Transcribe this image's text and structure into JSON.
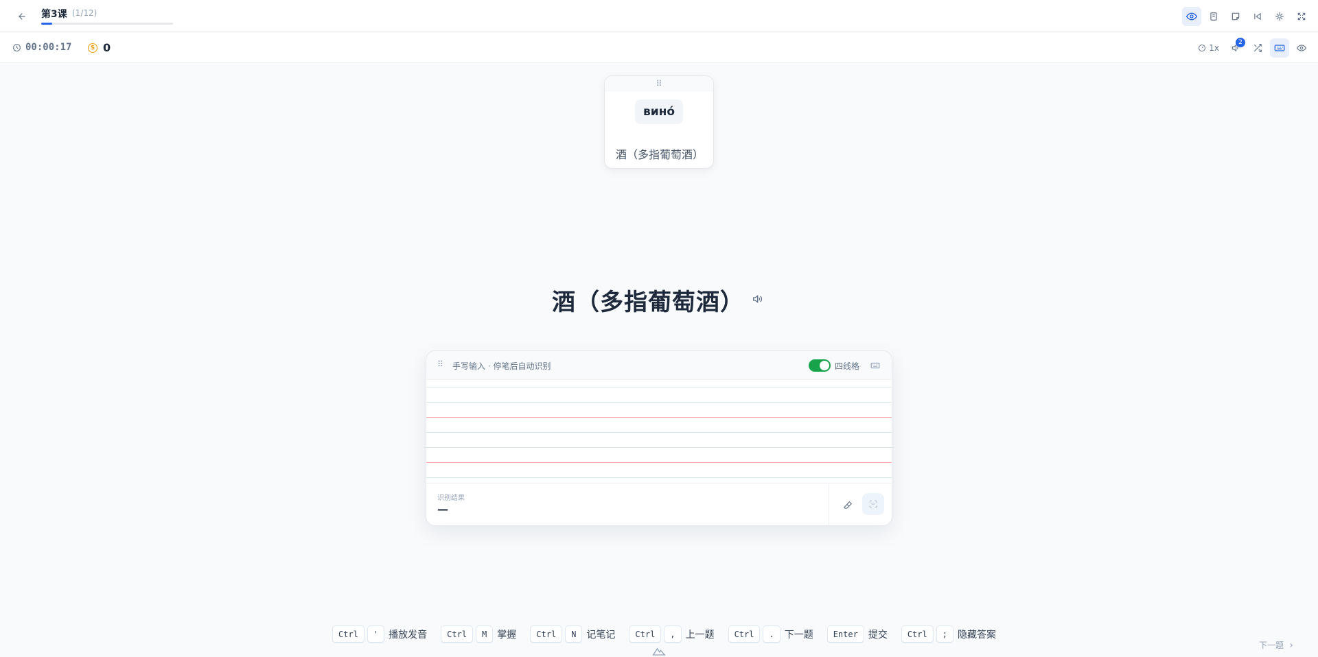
{
  "header": {
    "lesson_title": "第3课",
    "lesson_count": "(1/12)",
    "progress_fraction": 0.0833,
    "icons": [
      "eye-icon",
      "book-icon",
      "note-icon",
      "skip-back-icon",
      "bug-icon",
      "fullscreen-icon"
    ]
  },
  "toolbar": {
    "timer": "00:00:17",
    "coins": "0",
    "speed": "1x",
    "audio_badge": "2"
  },
  "card": {
    "word": "вино́",
    "meaning": "酒（多指葡萄酒）"
  },
  "prompt": {
    "text": "酒（多指葡萄酒）"
  },
  "handwriting": {
    "hint": "手写输入 · 停笔后自动识别",
    "grid_toggle_label": "四线格",
    "grid_enabled": true,
    "result_label": "识别结果",
    "result_value": "—"
  },
  "shortcuts": [
    {
      "keys": [
        "Ctrl",
        "'"
      ],
      "label": "播放发音"
    },
    {
      "keys": [
        "Ctrl",
        "M"
      ],
      "label": "掌握"
    },
    {
      "keys": [
        "Ctrl",
        "N"
      ],
      "label": "记笔记"
    },
    {
      "keys": [
        "Ctrl",
        ","
      ],
      "label": "上一题"
    },
    {
      "keys": [
        "Ctrl",
        "."
      ],
      "label": "下一题"
    },
    {
      "keys": [
        "Enter"
      ],
      "label": "提交"
    },
    {
      "keys": [
        "Ctrl",
        ";"
      ],
      "label": "隐藏答案"
    }
  ],
  "footer": {
    "next_label": "下一题"
  },
  "colors": {
    "accent": "#2563eb",
    "toggle_on": "#16a34a",
    "coin": "#f59e0b",
    "baseline_red": "#fca5a5",
    "guide_line": "#d1e7e4"
  }
}
